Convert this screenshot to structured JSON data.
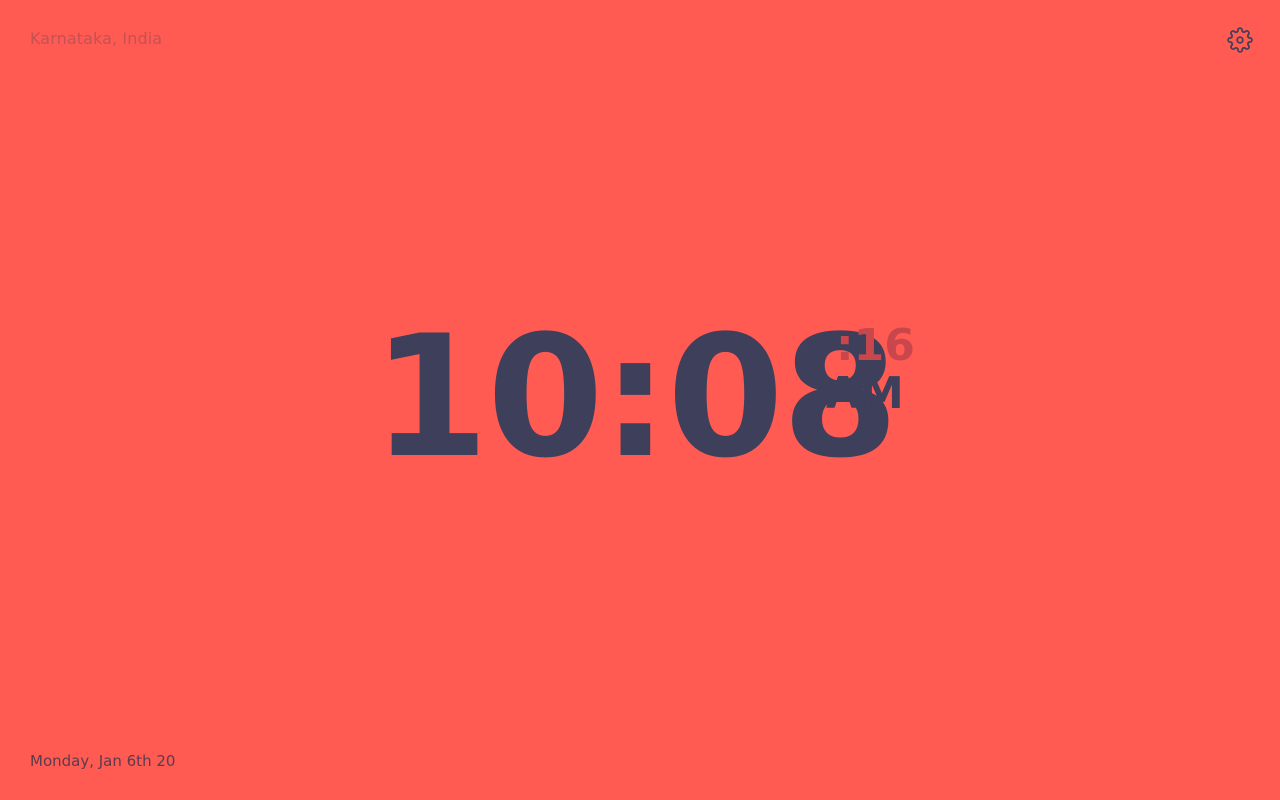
{
  "location": "Karnataka, India",
  "settings": {
    "icon": "gear-icon"
  },
  "clock": {
    "time": "10:08",
    "seconds": ":16",
    "period": "AM"
  },
  "date": "Monday, Jan 6th 20",
  "colors": {
    "background": "#ff5b52",
    "time": "#3d3f5b",
    "seconds": "#c9474c",
    "location": "#c45154",
    "date": "#5a3c4c"
  }
}
